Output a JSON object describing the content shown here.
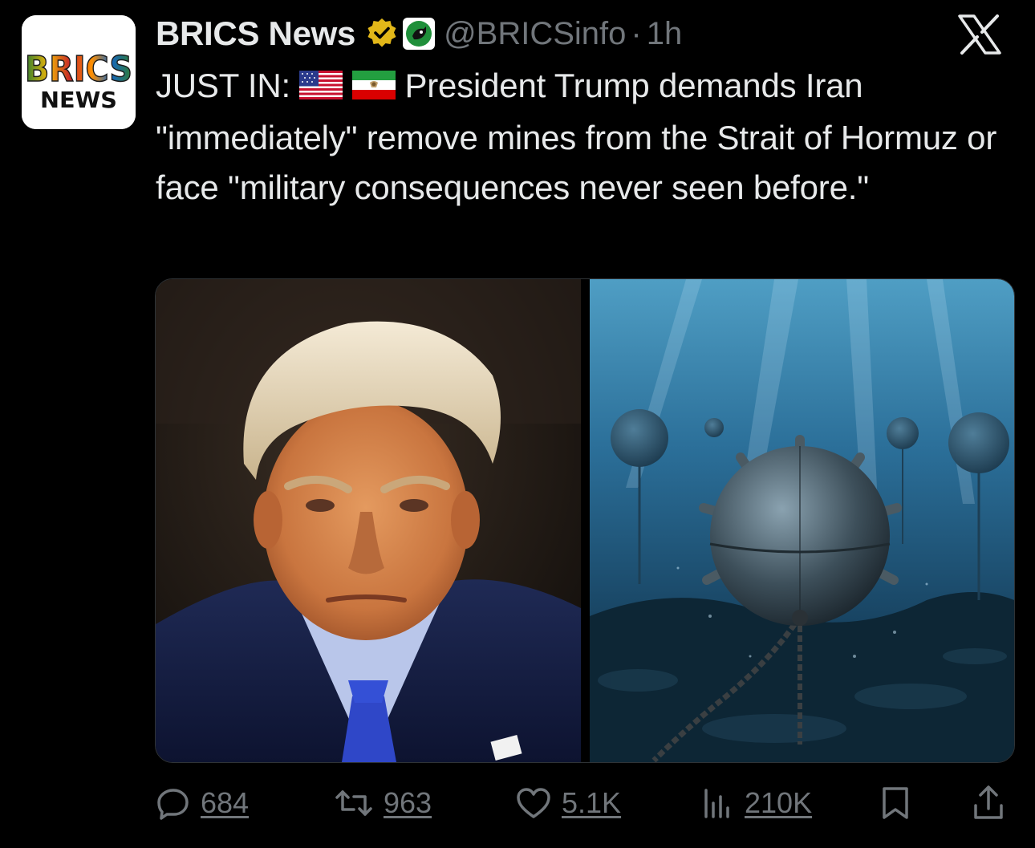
{
  "author": {
    "avatar_line1": "BRICS",
    "avatar_line2": "NEWS",
    "display_name": "BRICS News",
    "verified_icon": "gold-verified-badge",
    "affiliate_icon": "affiliate-badge",
    "handle": "@BRICSinfo",
    "separator": "·",
    "time": "1h"
  },
  "app_icon": "x-logo-icon",
  "tweet": {
    "prefix": "JUST IN:",
    "flags": [
      "us-flag",
      "iran-flag"
    ],
    "body": "President Trump demands Iran \"immediately\" remove mines from the Strait of Hormuz or face \"military consequences never seen before.\""
  },
  "media": [
    {
      "description_icon": "photo-man-portrait"
    },
    {
      "description_icon": "photo-underwater-sea-mines"
    }
  ],
  "actions": {
    "replies": "684",
    "reposts": "963",
    "likes": "5.1K",
    "views": "210K"
  },
  "colors": {
    "background": "#000000",
    "text": "#e7e9ea",
    "muted": "#71767b",
    "verified_gold": "#e2b719"
  }
}
